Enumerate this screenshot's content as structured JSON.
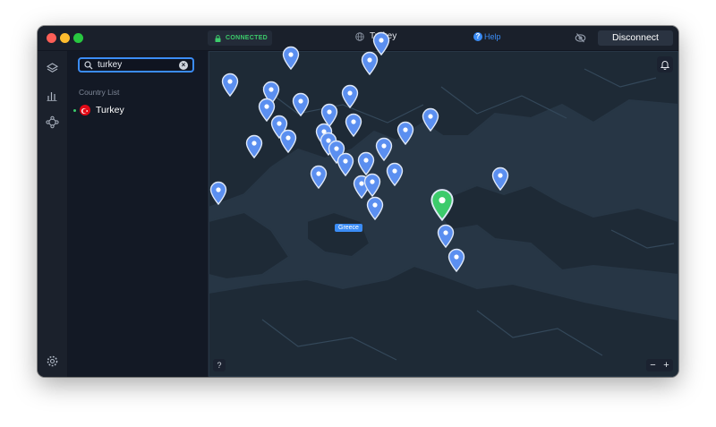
{
  "titlebar": {
    "status": "CONNECTED",
    "country": "Turkey",
    "help": "Help",
    "disconnect": "Disconnect"
  },
  "sidebar": {
    "search": {
      "value": "turkey"
    },
    "list_header": "Country List",
    "countries": [
      {
        "name": "Turkey",
        "connected": true
      }
    ]
  },
  "map": {
    "hover_label": "Greece",
    "help_button": "?",
    "zoom_out": "−",
    "zoom_in": "+"
  },
  "colors": {
    "accent": "#3b8cf5",
    "connected": "#3ccb6b",
    "map_sea": "#273645",
    "map_land": "#1e2a36"
  },
  "icons": [
    "lock-icon",
    "globe-icon",
    "help-icon",
    "eye-off-icon",
    "layers-icon",
    "stats-icon",
    "nodes-icon",
    "settings-icon",
    "search-icon",
    "clear-icon",
    "bell-icon",
    "location-pin-icon"
  ]
}
